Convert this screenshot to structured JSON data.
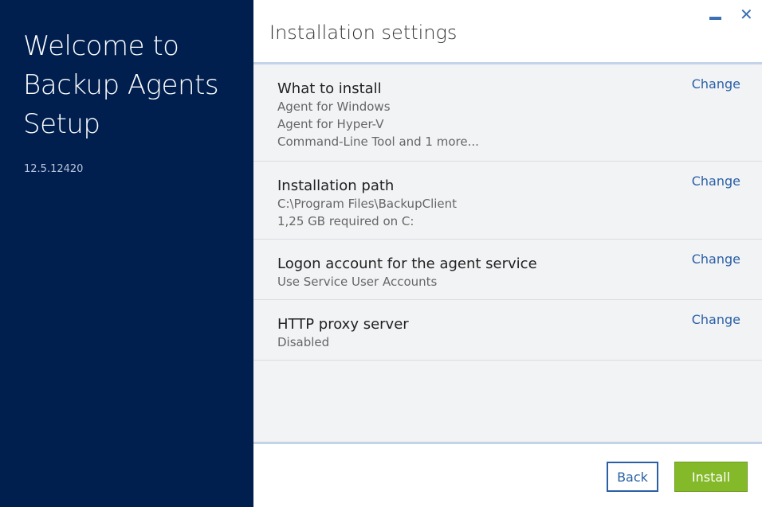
{
  "sidebar": {
    "welcome_line1": "Welcome to",
    "welcome_line2": "Backup Agents",
    "welcome_line3": "Setup",
    "version": "12.5.12420"
  },
  "window": {
    "title": "Installation settings",
    "minimize_icon": "minimize-icon",
    "close_icon": "close-icon",
    "close_glyph": "✕"
  },
  "sections": [
    {
      "title": "What to install",
      "lines": [
        "Agent for Windows",
        "Agent for Hyper-V",
        "Command-Line Tool and 1 more..."
      ],
      "action": "Change"
    },
    {
      "title": "Installation path",
      "lines": [
        "C:\\Program Files\\BackupClient",
        "1,25 GB required on C:"
      ],
      "action": "Change"
    },
    {
      "title": "Logon account for the agent service",
      "lines": [
        "Use Service User Accounts"
      ],
      "action": "Change"
    },
    {
      "title": "HTTP proxy server",
      "lines": [
        "Disabled"
      ],
      "action": "Change"
    }
  ],
  "footer": {
    "back_label": "Back",
    "install_label": "Install"
  },
  "colors": {
    "sidebar_bg": "#001f4f",
    "accent_blue": "#2a5fa6",
    "install_green": "#84b92a"
  }
}
